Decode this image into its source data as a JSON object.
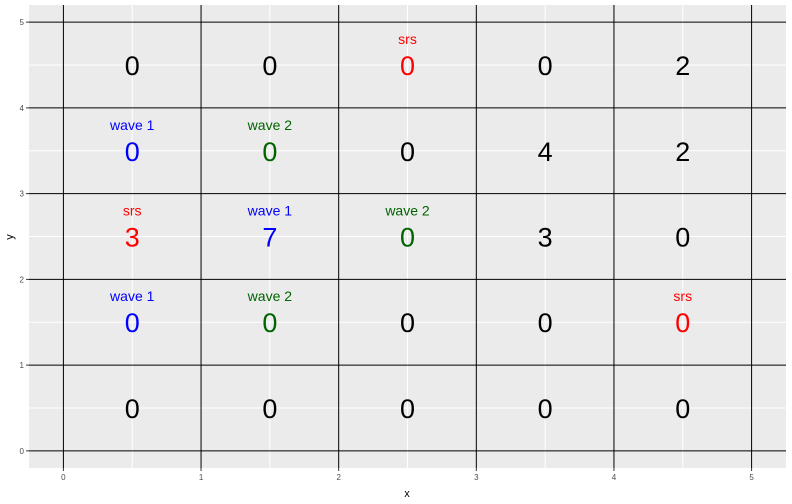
{
  "chart_data": {
    "type": "scatter",
    "xlabel": "x",
    "ylabel": "y",
    "xlim": [
      -0.25,
      5.25
    ],
    "ylim": [
      -0.2,
      5.2
    ],
    "x_ticks": [
      "0",
      "1",
      "2",
      "3",
      "4",
      "5"
    ],
    "y_ticks": [
      "0",
      "1",
      "2",
      "3",
      "4",
      "5"
    ],
    "grid_lines": [
      0,
      1,
      2,
      3,
      4,
      5
    ],
    "colors": {
      "panel_background": "#ebebeb",
      "minor_grid": "#ffffff",
      "grid_lines": "#000000",
      "srs": "#ff0000",
      "wave 1": "#0000ff",
      "wave 2": "#006400",
      "none": "#000000"
    },
    "cells": [
      {
        "x": 0.5,
        "y": 4.5,
        "count": "0",
        "label": ""
      },
      {
        "x": 1.5,
        "y": 4.5,
        "count": "0",
        "label": ""
      },
      {
        "x": 2.5,
        "y": 4.5,
        "count": "0",
        "label": "srs"
      },
      {
        "x": 3.5,
        "y": 4.5,
        "count": "0",
        "label": ""
      },
      {
        "x": 4.5,
        "y": 4.5,
        "count": "2",
        "label": ""
      },
      {
        "x": 0.5,
        "y": 3.5,
        "count": "0",
        "label": "wave 1"
      },
      {
        "x": 1.5,
        "y": 3.5,
        "count": "0",
        "label": "wave 2"
      },
      {
        "x": 2.5,
        "y": 3.5,
        "count": "0",
        "label": ""
      },
      {
        "x": 3.5,
        "y": 3.5,
        "count": "4",
        "label": ""
      },
      {
        "x": 4.5,
        "y": 3.5,
        "count": "2",
        "label": ""
      },
      {
        "x": 0.5,
        "y": 2.5,
        "count": "3",
        "label": "srs"
      },
      {
        "x": 1.5,
        "y": 2.5,
        "count": "7",
        "label": "wave 1"
      },
      {
        "x": 2.5,
        "y": 2.5,
        "count": "0",
        "label": "wave 2"
      },
      {
        "x": 3.5,
        "y": 2.5,
        "count": "3",
        "label": ""
      },
      {
        "x": 4.5,
        "y": 2.5,
        "count": "0",
        "label": ""
      },
      {
        "x": 0.5,
        "y": 1.5,
        "count": "0",
        "label": "wave 1"
      },
      {
        "x": 1.5,
        "y": 1.5,
        "count": "0",
        "label": "wave 2"
      },
      {
        "x": 2.5,
        "y": 1.5,
        "count": "0",
        "label": ""
      },
      {
        "x": 3.5,
        "y": 1.5,
        "count": "0",
        "label": ""
      },
      {
        "x": 4.5,
        "y": 1.5,
        "count": "0",
        "label": "srs"
      },
      {
        "x": 0.5,
        "y": 0.5,
        "count": "0",
        "label": ""
      },
      {
        "x": 1.5,
        "y": 0.5,
        "count": "0",
        "label": ""
      },
      {
        "x": 2.5,
        "y": 0.5,
        "count": "0",
        "label": ""
      },
      {
        "x": 3.5,
        "y": 0.5,
        "count": "0",
        "label": ""
      },
      {
        "x": 4.5,
        "y": 0.5,
        "count": "0",
        "label": ""
      }
    ]
  }
}
